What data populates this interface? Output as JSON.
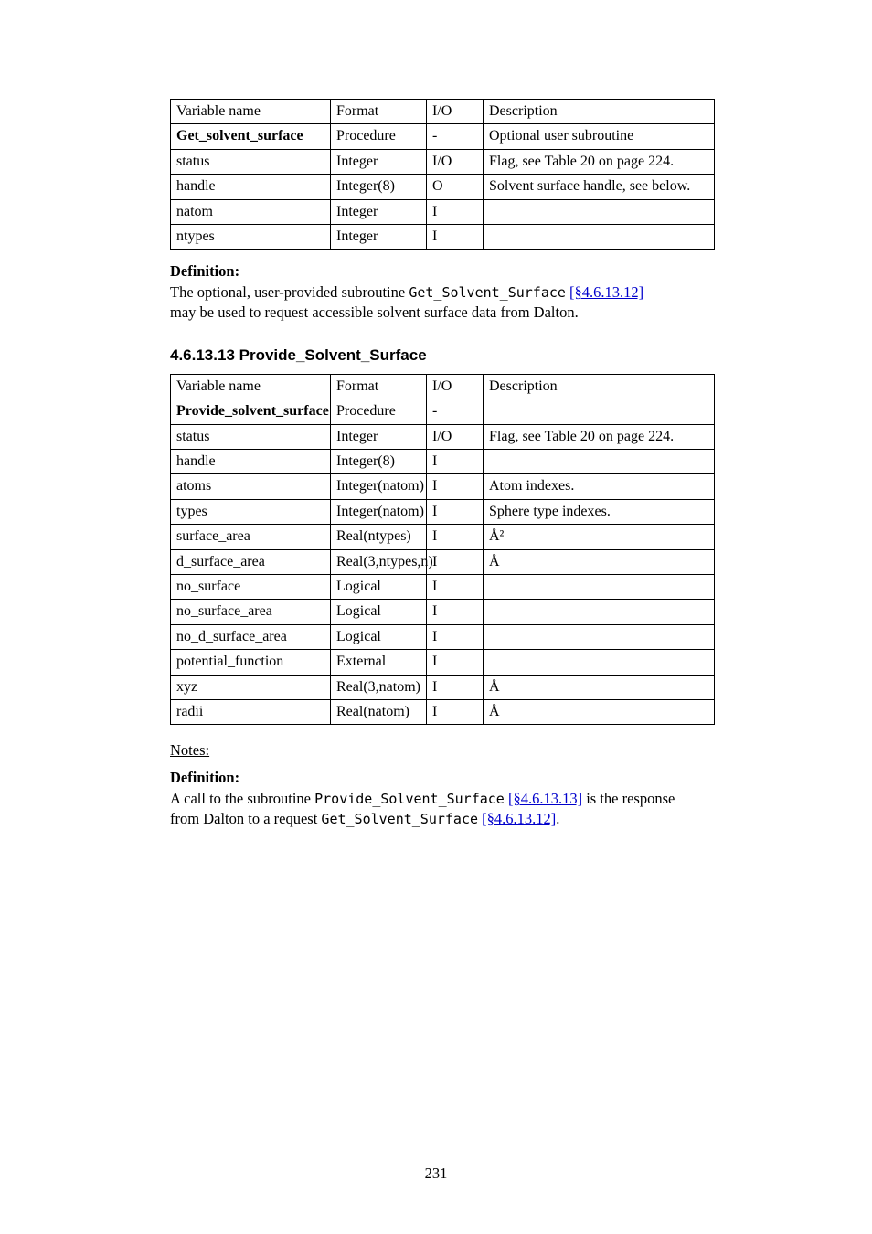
{
  "tables": [
    {
      "id": "get-solvent-surface",
      "caption_before": null,
      "headers": [
        "Variable name",
        "Format",
        "I/O",
        "Description"
      ],
      "rows": [
        [
          {
            "bold": true,
            "text": "Get_solvent_surface"
          },
          {
            "text": "Procedure"
          },
          {
            "text": "-"
          },
          {
            "text": "Optional user subroutine"
          }
        ],
        [
          {
            "text": "status"
          },
          {
            "text": "Integer"
          },
          {
            "text": "I/O"
          },
          {
            "text": "Flag, see Table 20 on page 224."
          }
        ],
        [
          {
            "text": "handle"
          },
          {
            "text": "Integer(8)"
          },
          {
            "text": "O"
          },
          {
            "text": "Solvent surface handle, see below."
          }
        ],
        [
          {
            "text": "natom"
          },
          {
            "text": "Integer"
          },
          {
            "text": "I"
          },
          {
            "text": ""
          }
        ],
        [
          {
            "text": "ntypes"
          },
          {
            "text": "Integer"
          },
          {
            "text": "I"
          },
          {
            "text": ""
          }
        ]
      ]
    },
    {
      "id": "provide-solvent-surface",
      "headers": [
        "Variable name",
        "Format",
        "I/O",
        "Description"
      ],
      "rows": [
        [
          {
            "bold": true,
            "text": "Provide_solvent_surface"
          },
          {
            "text": "Procedure"
          },
          {
            "text": "-"
          },
          {
            "text": ""
          }
        ],
        [
          {
            "text": "status"
          },
          {
            "text": "Integer"
          },
          {
            "text": "I/O"
          },
          {
            "text": "Flag, see Table 20 on page 224."
          }
        ],
        [
          {
            "text": "handle"
          },
          {
            "text": "Integer(8)"
          },
          {
            "text": "I"
          },
          {
            "text": ""
          }
        ],
        [
          {
            "text": "atoms"
          },
          {
            "text": "Integer(natom)"
          },
          {
            "text": "I"
          },
          {
            "text": "Atom indexes."
          }
        ],
        [
          {
            "text": "types"
          },
          {
            "text": "Integer(natom)"
          },
          {
            "text": "I"
          },
          {
            "text": "Sphere type indexes."
          }
        ],
        [
          {
            "text": "surface_area"
          },
          {
            "text": "Real(ntypes)"
          },
          {
            "text": "I"
          },
          {
            "text": "Å²"
          }
        ],
        [
          {
            "text": "d_surface_area"
          },
          {
            "text": "Real(3,ntypes,n)"
          },
          {
            "text": "I"
          },
          {
            "text": "Å"
          }
        ],
        [
          {
            "text": "no_surface"
          },
          {
            "text": "Logical"
          },
          {
            "text": "I"
          },
          {
            "text": ""
          }
        ],
        [
          {
            "text": "no_surface_area"
          },
          {
            "text": "Logical"
          },
          {
            "text": "I"
          },
          {
            "text": ""
          }
        ],
        [
          {
            "text": "no_d_surface_area"
          },
          {
            "text": "Logical"
          },
          {
            "text": "I"
          },
          {
            "text": ""
          }
        ],
        [
          {
            "text": "potential_function"
          },
          {
            "text": "External"
          },
          {
            "text": "I"
          },
          {
            "text": ""
          }
        ],
        [
          {
            "text": "xyz"
          },
          {
            "text": "Real(3,natom)"
          },
          {
            "text": "I"
          },
          {
            "text": "Å"
          }
        ],
        [
          {
            "text": "radii"
          },
          {
            "text": "Real(natom)"
          },
          {
            "text": "I"
          },
          {
            "text": "Å"
          }
        ]
      ]
    }
  ],
  "between_tables": {
    "def_label": "Definition:",
    "def_lines": [
      {
        "prefix": "The optional, user-provided subroutine ",
        "code": "Get_Solvent_Surface",
        "link_text": "[§4.6.13.12]",
        "suffix": ""
      },
      {
        "text": "may be used to request accessible solvent surface data from Dalton."
      }
    ]
  },
  "section_title": "4.6.13.13 Provide_Solvent_Surface",
  "after_second": {
    "notes_label": "Notes:",
    "def_label": "Definition:",
    "def_lines": [
      {
        "prefix": "A call to the subroutine ",
        "code": "Provide_Solvent_Surface",
        "link_text": "[§4.6.13.13]",
        "suffix": " is the response"
      },
      {
        "prefix": "from Dalton to a request ",
        "code": "Get_Solvent_Surface",
        "link_text": "[§4.6.13.12]",
        "suffix": "."
      }
    ]
  },
  "footer": "231"
}
